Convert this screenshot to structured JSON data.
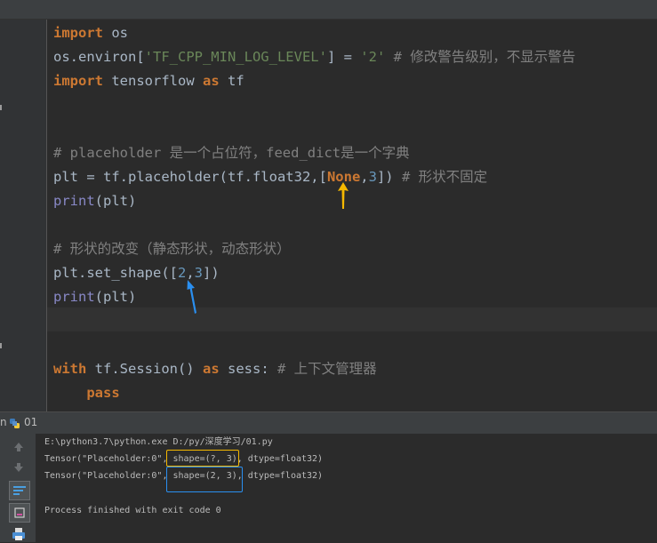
{
  "editor": {
    "lines": [
      {
        "tokens": [
          {
            "t": "import",
            "c": "kw"
          },
          {
            "t": " os",
            "c": "plain"
          }
        ]
      },
      {
        "tokens": [
          {
            "t": "os.environ[",
            "c": "plain"
          },
          {
            "t": "'TF_CPP_MIN_LOG_LEVEL'",
            "c": "str"
          },
          {
            "t": "] = ",
            "c": "plain"
          },
          {
            "t": "'2'",
            "c": "str"
          },
          {
            "t": " # 修改警告级别，不显示警告",
            "c": "cmt"
          }
        ]
      },
      {
        "tokens": [
          {
            "t": "import",
            "c": "kw"
          },
          {
            "t": " tensorflow ",
            "c": "plain"
          },
          {
            "t": "as",
            "c": "kw"
          },
          {
            "t": " tf",
            "c": "plain"
          }
        ]
      },
      {
        "tokens": []
      },
      {
        "tokens": []
      },
      {
        "tokens": [
          {
            "t": "# placeholder 是一个占位符，feed_dict是一个字典",
            "c": "cmt"
          }
        ]
      },
      {
        "tokens": [
          {
            "t": "plt = tf.placeholder(tf.float32,[",
            "c": "plain"
          },
          {
            "t": "None",
            "c": "none"
          },
          {
            "t": ",",
            "c": "plain"
          },
          {
            "t": "3",
            "c": "num"
          },
          {
            "t": "]) ",
            "c": "plain"
          },
          {
            "t": "# 形状不固定",
            "c": "cmt"
          }
        ]
      },
      {
        "tokens": [
          {
            "t": "print",
            "c": "bi"
          },
          {
            "t": "(plt)",
            "c": "plain"
          }
        ]
      },
      {
        "tokens": []
      },
      {
        "tokens": [
          {
            "t": "# 形状的改变（静态形状，动态形状）",
            "c": "cmt"
          }
        ]
      },
      {
        "tokens": [
          {
            "t": "plt.set_shape([",
            "c": "plain"
          },
          {
            "t": "2",
            "c": "num"
          },
          {
            "t": ",",
            "c": "plain"
          },
          {
            "t": "3",
            "c": "num"
          },
          {
            "t": "])",
            "c": "plain"
          }
        ]
      },
      {
        "tokens": [
          {
            "t": "print",
            "c": "bi"
          },
          {
            "t": "(plt)",
            "c": "plain"
          }
        ]
      },
      {
        "tokens": []
      },
      {
        "tokens": []
      },
      {
        "tokens": [
          {
            "t": "with",
            "c": "kw"
          },
          {
            "t": " tf.Session() ",
            "c": "plain"
          },
          {
            "t": "as",
            "c": "kw"
          },
          {
            "t": " sess: ",
            "c": "plain"
          },
          {
            "t": "# 上下文管理器",
            "c": "cmt"
          }
        ]
      },
      {
        "tokens": [
          {
            "t": "    ",
            "c": "plain"
          },
          {
            "t": "pass",
            "c": "kw"
          }
        ]
      }
    ]
  },
  "run_panel": {
    "label_fragment": "n",
    "tab_name": "01"
  },
  "console": {
    "cmd": "E:\\python3.7\\python.exe D:/py/深度学习/01.py",
    "out1_prefix": "Tensor(\"Placeholder:0\",",
    "out1_shape": "shape=(?, 3)",
    "out1_suffix": ", dtype=float32)",
    "out2_prefix": "Tensor(\"Placeholder:0\",",
    "out2_shape": "shape=(2, 3)",
    "out2_suffix": ", dtype=float32)",
    "finished": "Process finished with exit code 0"
  },
  "colors": {
    "keyword": "#cc7832",
    "string": "#6a8759",
    "number": "#6897bb",
    "comment": "#808080",
    "builtin": "#8888c6",
    "annotation_yellow": "#f5b800",
    "annotation_blue": "#2a8ff0"
  },
  "icons": [
    "up-arrow-icon",
    "down-arrow-icon",
    "soft-wrap-icon",
    "scroll-to-end-icon",
    "print-icon",
    "python-icon"
  ]
}
